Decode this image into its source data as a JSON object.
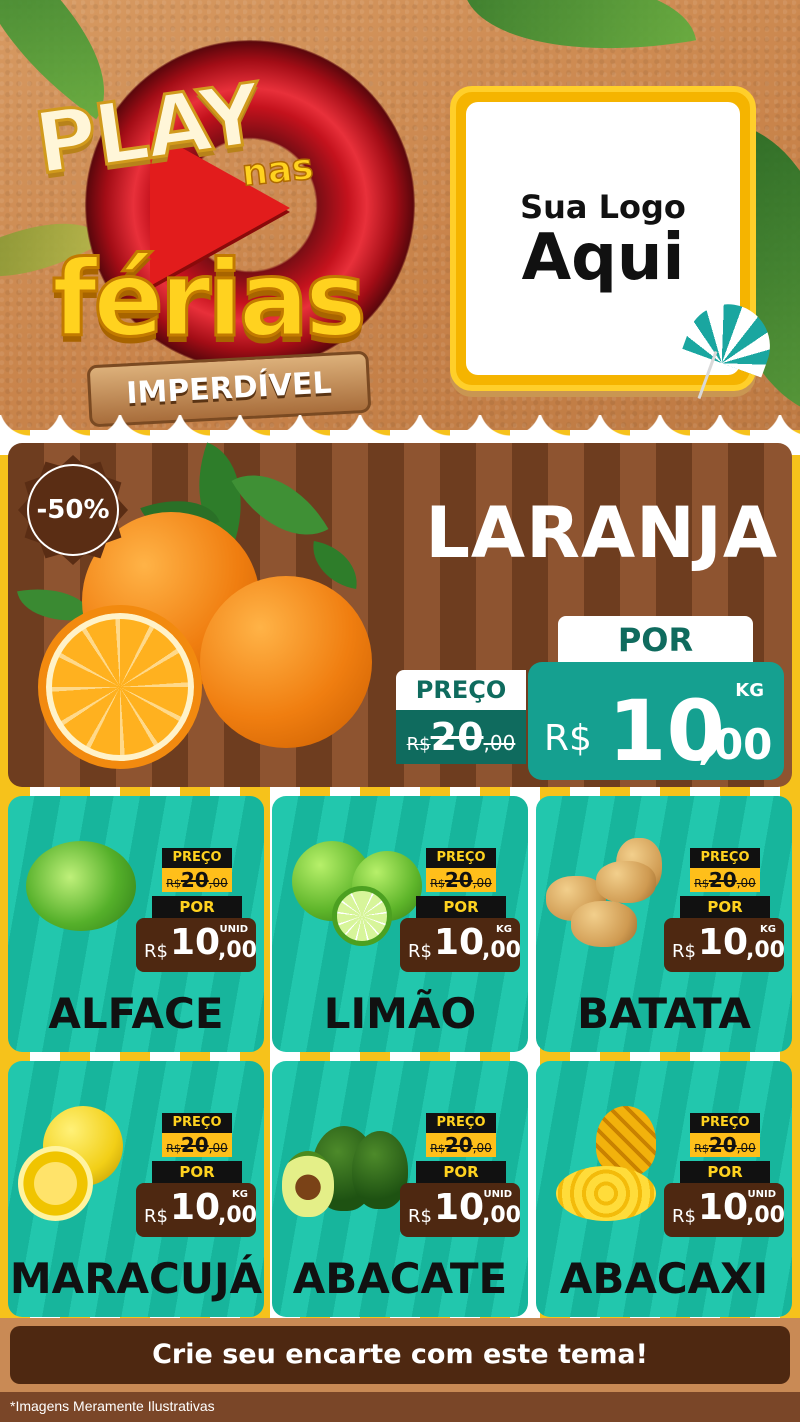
{
  "header": {
    "logo_play": "PLAY",
    "logo_nas": "nas",
    "logo_ferias": "férias",
    "logo_imperdivel": "IMPERDÍVEL",
    "logo_box_line1": "Sua Logo",
    "logo_box_line2": "Aqui"
  },
  "featured": {
    "badge": "-50%",
    "name": "LARANJA",
    "por_label": "POR",
    "preco_label": "PREÇO",
    "old_price": {
      "currency": "R$",
      "integer": "20",
      "cents": ",00"
    },
    "new_price": {
      "currency": "R$",
      "integer": "10",
      "cents": ",00",
      "unit": "KG"
    }
  },
  "products": [
    {
      "name": "ALFACE",
      "preco_label": "PREÇO",
      "por_label": "POR",
      "old_currency": "R$",
      "old_integer": "20",
      "old_cents": ",00",
      "currency": "R$",
      "integer": "10",
      "cents": ",00",
      "unit": "UNID"
    },
    {
      "name": "LIMÃO",
      "preco_label": "PREÇO",
      "por_label": "POR",
      "old_currency": "R$",
      "old_integer": "20",
      "old_cents": ",00",
      "currency": "R$",
      "integer": "10",
      "cents": ",00",
      "unit": "KG"
    },
    {
      "name": "BATATA",
      "preco_label": "PREÇO",
      "por_label": "POR",
      "old_currency": "R$",
      "old_integer": "20",
      "old_cents": ",00",
      "currency": "R$",
      "integer": "10",
      "cents": ",00",
      "unit": "KG"
    },
    {
      "name": "MARACUJÁ",
      "preco_label": "PREÇO",
      "por_label": "POR",
      "old_currency": "R$",
      "old_integer": "20",
      "old_cents": ",00",
      "currency": "R$",
      "integer": "10",
      "cents": ",00",
      "unit": "KG"
    },
    {
      "name": "ABACATE",
      "preco_label": "PREÇO",
      "por_label": "POR",
      "old_currency": "R$",
      "old_integer": "20",
      "old_cents": ",00",
      "currency": "R$",
      "integer": "10",
      "cents": ",00",
      "unit": "UNID"
    },
    {
      "name": "ABACAXI",
      "preco_label": "PREÇO",
      "por_label": "POR",
      "old_currency": "R$",
      "old_integer": "20",
      "old_cents": ",00",
      "currency": "R$",
      "integer": "10",
      "cents": ",00",
      "unit": "UNID"
    }
  ],
  "footer": {
    "cta": "Crie seu encarte com este tema!",
    "disclaimer": "*Imagens Meramente Ilustrativas"
  },
  "colors": {
    "brown": "#4e2811",
    "teal": "#15a090",
    "yellow": "#ffd21f",
    "sand": "#c98a55"
  }
}
